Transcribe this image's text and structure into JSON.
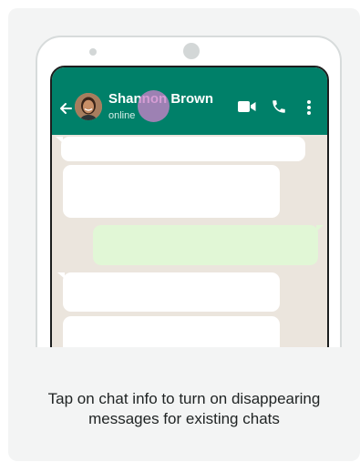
{
  "chat_header": {
    "contact_name": "Shannon Brown",
    "status": "online",
    "icons": [
      "back-arrow-icon",
      "video-call-icon",
      "voice-call-icon",
      "more-options-icon"
    ]
  },
  "colors": {
    "app_bar": "#008069",
    "chat_background": "#ebe5dd",
    "incoming_bubble": "#ffffff",
    "outgoing_bubble": "#e1f7d6",
    "tap_indicator": "#c982c8"
  },
  "caption": {
    "line1": "Tap on chat info to turn on disappearing",
    "line2": "messages for existing chats"
  }
}
